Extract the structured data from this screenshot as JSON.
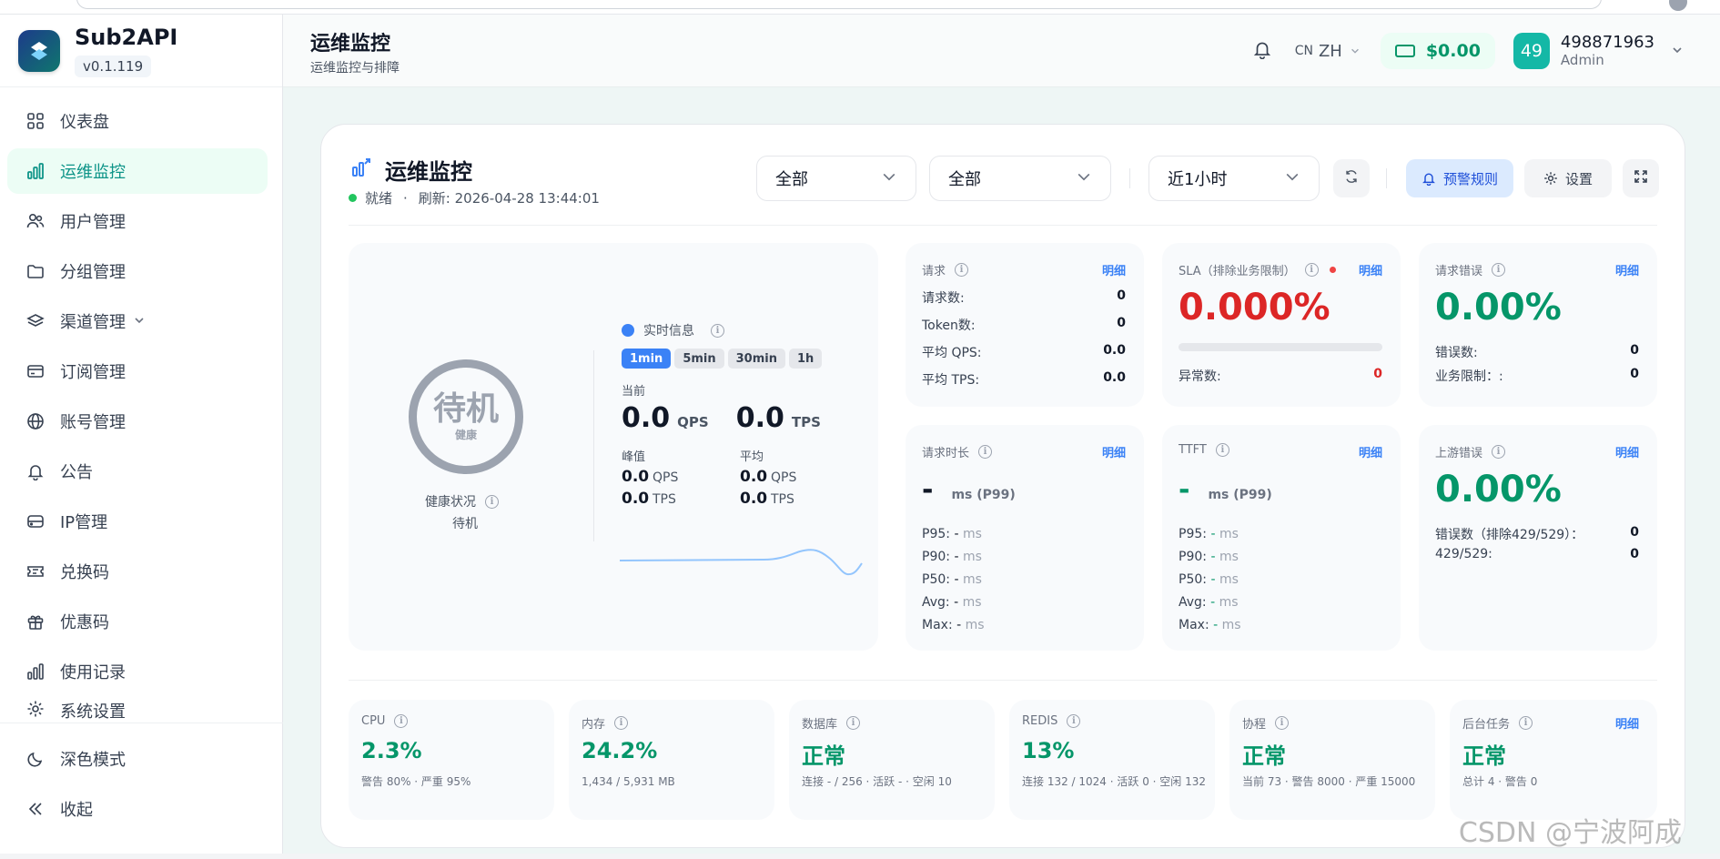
{
  "sidebar": {
    "brand_name": "Sub2API",
    "version": "v0.1.119",
    "items": [
      {
        "label": "仪表盘",
        "icon": "dashboard-grid-icon"
      },
      {
        "label": "运维监控",
        "icon": "bar-chart-icon",
        "active": true
      },
      {
        "label": "用户管理",
        "icon": "users-icon"
      },
      {
        "label": "分组管理",
        "icon": "folder-icon"
      },
      {
        "label": "渠道管理",
        "icon": "layers-icon",
        "has_submenu": true
      },
      {
        "label": "订阅管理",
        "icon": "card-icon"
      },
      {
        "label": "账号管理",
        "icon": "globe-icon"
      },
      {
        "label": "公告",
        "icon": "bell-icon"
      },
      {
        "label": "IP管理",
        "icon": "server-icon"
      },
      {
        "label": "兑换码",
        "icon": "ticket-icon"
      },
      {
        "label": "优惠码",
        "icon": "gift-icon"
      },
      {
        "label": "使用记录",
        "icon": "bar-chart-icon"
      },
      {
        "label": "系统设置",
        "icon": "gear-icon"
      }
    ],
    "dark_mode": "深色模式",
    "collapse": "收起"
  },
  "header": {
    "title": "运维监控",
    "subtitle": "运维监控与排障",
    "lang_prefix": "CN",
    "lang": "ZH",
    "balance": "$0.00",
    "avatar_text": "49",
    "username": "498871963",
    "role": "Admin"
  },
  "card": {
    "title": "运维监控",
    "status": "就绪",
    "separator": "·",
    "refresh": "刷新: 2026-04-28 13:44:01",
    "filter1": "全部",
    "filter2": "全部",
    "time_range": "近1小时",
    "alert_rules": "预警规则",
    "settings": "设置"
  },
  "health": {
    "state": "待机",
    "state_sub": "健康",
    "label": "健康状况",
    "value": "待机",
    "realtime_title": "实时信息",
    "chips": [
      "1min",
      "5min",
      "30min",
      "1h"
    ],
    "active_chip": "1min",
    "current_label": "当前",
    "current_qps": "0.0",
    "current_tps": "0.0",
    "qps_unit": "QPS",
    "tps_unit": "TPS",
    "peak_label": "峰值",
    "avg_label": "平均",
    "peak_qps": "0.0",
    "peak_tps": "0.0",
    "avg_qps": "0.0",
    "avg_tps": "0.0"
  },
  "requests": {
    "title": "请求",
    "detail": "明细",
    "rows": [
      {
        "k": "请求数:",
        "v": "0"
      },
      {
        "k": "Token数:",
        "v": "0"
      },
      {
        "k": "平均 QPS:",
        "v": "0.0"
      },
      {
        "k": "平均 TPS:",
        "v": "0.0"
      }
    ]
  },
  "sla": {
    "title": "SLA（排除业务限制）",
    "detail": "明细",
    "value": "0.000%",
    "progress": 0,
    "abn_label": "异常数:",
    "abn_value": "0"
  },
  "req_errors": {
    "title": "请求错误",
    "detail": "明细",
    "value": "0.00%",
    "rows": [
      {
        "k": "错误数:",
        "v": "0"
      },
      {
        "k": "业务限制：:",
        "v": "0"
      }
    ]
  },
  "duration": {
    "title": "请求时长",
    "detail": "明细",
    "main": "-",
    "main_unit": "ms (P99)",
    "rows": [
      {
        "k": "P95:",
        "v": "-",
        "u": "ms"
      },
      {
        "k": "P90:",
        "v": "-",
        "u": "ms"
      },
      {
        "k": "P50:",
        "v": "-",
        "u": "ms"
      },
      {
        "k": "Avg:",
        "v": "-",
        "u": "ms"
      },
      {
        "k": "Max:",
        "v": "-",
        "u": "ms"
      }
    ]
  },
  "ttft": {
    "title": "TTFT",
    "detail": "明细",
    "main": "-",
    "main_unit": "ms (P99)",
    "rows": [
      {
        "k": "P95:",
        "v": "-",
        "u": "ms"
      },
      {
        "k": "P90:",
        "v": "-",
        "u": "ms"
      },
      {
        "k": "P50:",
        "v": "-",
        "u": "ms"
      },
      {
        "k": "Avg:",
        "v": "-",
        "u": "ms"
      },
      {
        "k": "Max:",
        "v": "-",
        "u": "ms"
      }
    ]
  },
  "upstream_errors": {
    "title": "上游错误",
    "detail": "明细",
    "value": "0.00%",
    "rows": [
      {
        "k": "错误数（排除429/529）：",
        "v": "0"
      },
      {
        "k": "429/529:",
        "v": "0"
      }
    ]
  },
  "system": [
    {
      "title": "CPU",
      "value": "2.3%",
      "sub": "警告 80% · 严重 95%"
    },
    {
      "title": "内存",
      "value": "24.2%",
      "sub": "1,434 / 5,931 MB"
    },
    {
      "title": "数据库",
      "value": "正常",
      "sub": "连接 - / 256 · 活跃 - · 空闲 10"
    },
    {
      "title": "REDIS",
      "value": "13%",
      "sub": "连接 132 / 1024 · 活跃 0 · 空闲 132"
    },
    {
      "title": "协程",
      "value": "正常",
      "sub": "当前 73 · 警告 8000 · 严重 15000"
    },
    {
      "title": "后台任务",
      "value": "正常",
      "sub": "总计 4 · 警告 0",
      "detail": "明细"
    }
  ],
  "watermark": "CSDN @宁波阿成",
  "colors": {
    "accent": "#0d9488",
    "ok": "#059669",
    "error": "#dc2626",
    "link": "#3b82f6"
  }
}
